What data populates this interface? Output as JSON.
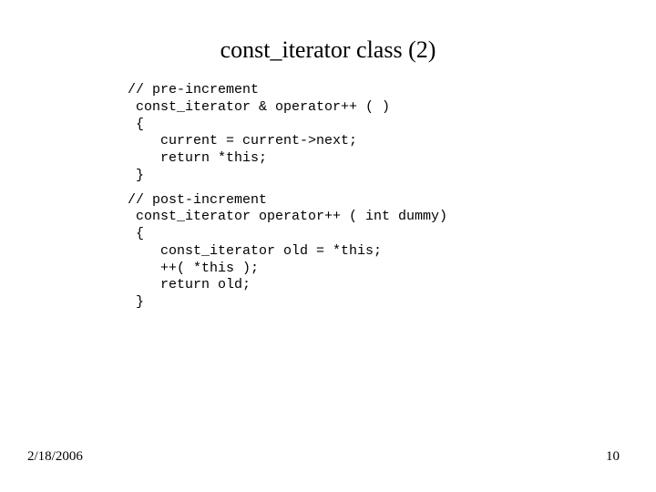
{
  "title": "const_iterator class (2)",
  "code1": "// pre-increment\n const_iterator & operator++ ( )\n {\n    current = current->next;\n    return *this;\n }",
  "code2": "// post-increment\n const_iterator operator++ ( int dummy)\n {\n    const_iterator old = *this;\n    ++( *this );\n    return old;\n }",
  "footer": {
    "date": "2/18/2006",
    "page": "10"
  }
}
